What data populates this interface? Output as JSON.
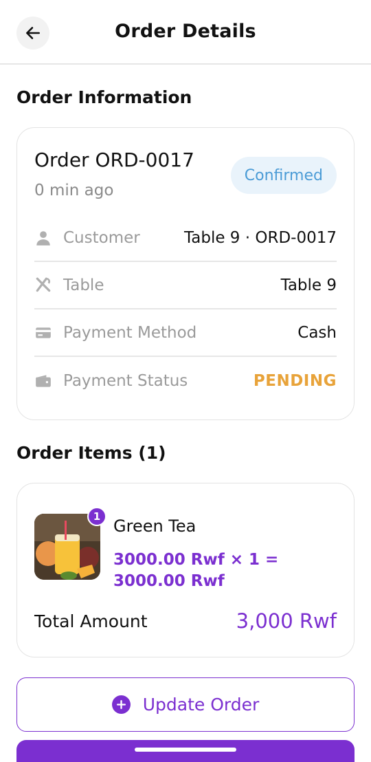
{
  "header": {
    "title": "Order Details",
    "back_icon": "arrow-left-icon"
  },
  "order_information": {
    "section_title": "Order Information",
    "order_id": "Order ORD-0017",
    "time_ago": "0 min ago",
    "status": "Confirmed",
    "rows": [
      {
        "icon": "person-icon",
        "label": "Customer",
        "value": "Table 9 · ORD-0017"
      },
      {
        "icon": "utensils-icon",
        "label": "Table",
        "value": "Table 9"
      },
      {
        "icon": "credit-card-icon",
        "label": "Payment Method",
        "value": "Cash"
      },
      {
        "icon": "wallet-icon",
        "label": "Payment Status",
        "value": "PENDING"
      }
    ]
  },
  "order_items": {
    "section_title": "Order Items (1)",
    "items": [
      {
        "quantity_badge": "1",
        "name": "Green Tea",
        "price_line": "3000.00 Rwf × 1 = 3000.00 Rwf"
      }
    ],
    "total_label": "Total Amount",
    "total_value": "3,000 Rwf"
  },
  "actions": {
    "update_label": "Update Order"
  },
  "colors": {
    "accent": "#7b2fd0",
    "status_confirmed": "#4a9bd6",
    "status_pending": "#e8a33a"
  }
}
